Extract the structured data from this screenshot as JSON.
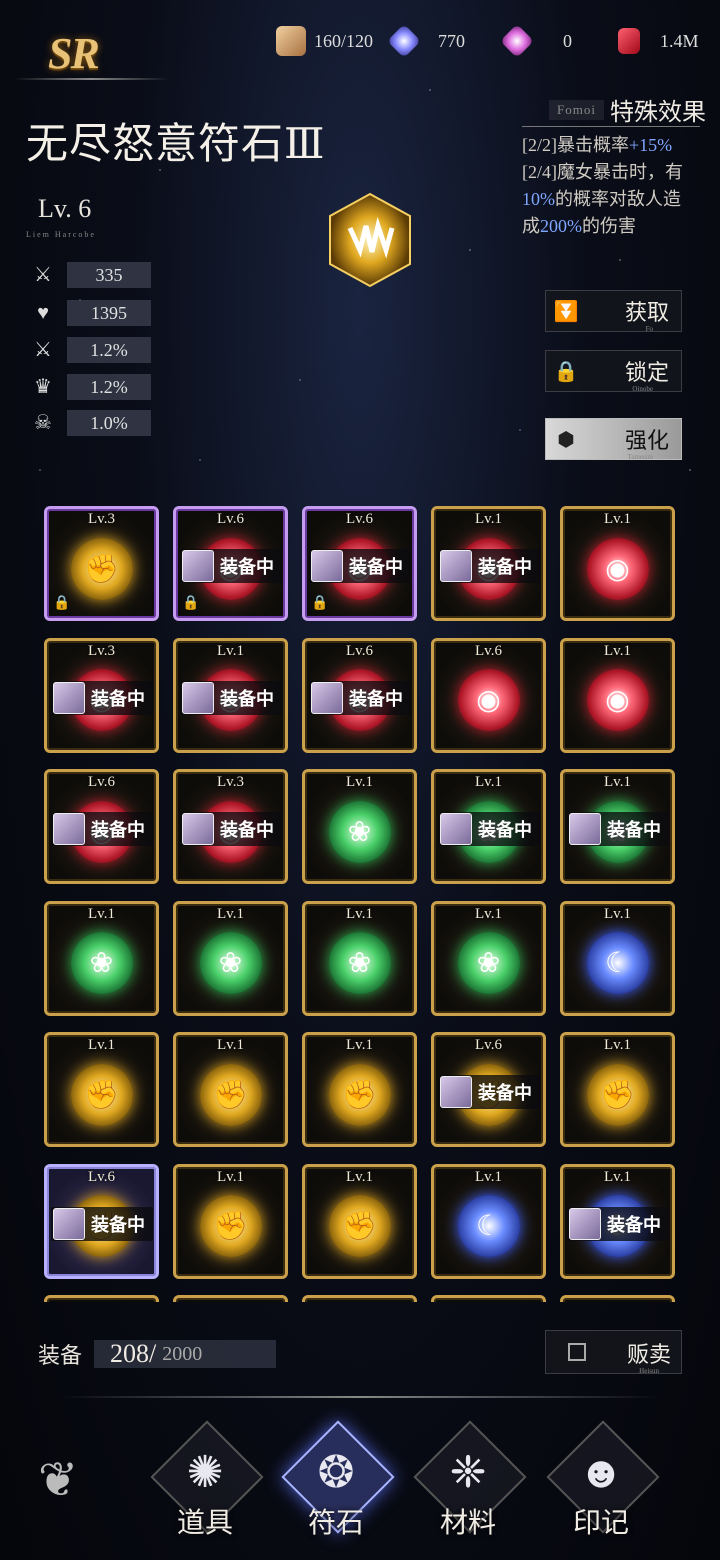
{
  "header": {
    "rarity": "SR",
    "currencies": [
      {
        "icon": "scroll-icon",
        "value": "160/120",
        "color": "#e0b070"
      },
      {
        "icon": "blue-crystal-icon",
        "value": "770",
        "color": "#8a8cff"
      },
      {
        "icon": "pink-crystal-icon",
        "value": "0",
        "color": "#e070e0"
      },
      {
        "icon": "red-gem-icon",
        "value": "1.4M",
        "color": "#e02030"
      }
    ]
  },
  "item": {
    "name": "无尽怒意符石Ⅲ",
    "level": "Lv.  6",
    "level_sub": "Liem Harcobe",
    "stats": [
      {
        "icon": "sword-icon",
        "value": "335"
      },
      {
        "icon": "heart-icon",
        "value": "1395"
      },
      {
        "icon": "crit-sword-icon",
        "value": "1.2%"
      },
      {
        "icon": "crown-icon",
        "value": "1.2%"
      },
      {
        "icon": "skull-icon",
        "value": "1.0%"
      }
    ]
  },
  "special": {
    "en": "Fomoi",
    "title": "特殊效果",
    "line1_prefix": "[2/2]暴击概率",
    "line1_value": "+15%",
    "line2_a": "[2/4]魔女暴击时，有",
    "line2_b": "10%",
    "line2_c": "的概率对敌人造",
    "line2_d": "成",
    "line2_e": "200%",
    "line2_f": "的伤害"
  },
  "buttons": {
    "obtain": {
      "label": "获取",
      "sub": "Fo"
    },
    "lock": {
      "label": "锁定",
      "sub": "Oinobe"
    },
    "enhance": {
      "label": "强化",
      "sub": "Tamesim"
    }
  },
  "grid": {
    "equipped_label": "装备中",
    "rows": [
      [
        {
          "lv": "Lv.3",
          "orb": "yellow",
          "frame": "purple",
          "equipped": false,
          "locked": true
        },
        {
          "lv": "Lv.6",
          "orb": "red",
          "frame": "purple",
          "equipped": true,
          "locked": true
        },
        {
          "lv": "Lv.6",
          "orb": "red",
          "frame": "purple",
          "equipped": true,
          "locked": true
        },
        {
          "lv": "Lv.1",
          "orb": "red",
          "frame": "gold",
          "equipped": true,
          "locked": false
        },
        {
          "lv": "Lv.1",
          "orb": "red",
          "frame": "gold",
          "equipped": false,
          "locked": false
        }
      ],
      [
        {
          "lv": "Lv.3",
          "orb": "red",
          "frame": "gold",
          "equipped": true,
          "locked": false
        },
        {
          "lv": "Lv.1",
          "orb": "red",
          "frame": "gold",
          "equipped": true,
          "locked": false
        },
        {
          "lv": "Lv.6",
          "orb": "red",
          "frame": "gold",
          "equipped": true,
          "locked": false
        },
        {
          "lv": "Lv.6",
          "orb": "red",
          "frame": "gold",
          "equipped": false,
          "locked": false
        },
        {
          "lv": "Lv.1",
          "orb": "red",
          "frame": "gold",
          "equipped": false,
          "locked": false
        }
      ],
      [
        {
          "lv": "Lv.6",
          "orb": "red",
          "frame": "gold",
          "equipped": true,
          "locked": false
        },
        {
          "lv": "Lv.3",
          "orb": "red",
          "frame": "gold",
          "equipped": true,
          "locked": false
        },
        {
          "lv": "Lv.1",
          "orb": "green",
          "frame": "gold",
          "equipped": false,
          "locked": false
        },
        {
          "lv": "Lv.1",
          "orb": "green",
          "frame": "gold",
          "equipped": true,
          "locked": false
        },
        {
          "lv": "Lv.1",
          "orb": "green",
          "frame": "gold",
          "equipped": true,
          "locked": false
        }
      ],
      [
        {
          "lv": "Lv.1",
          "orb": "green",
          "frame": "gold",
          "equipped": false,
          "locked": false
        },
        {
          "lv": "Lv.1",
          "orb": "green",
          "frame": "gold",
          "equipped": false,
          "locked": false
        },
        {
          "lv": "Lv.1",
          "orb": "green",
          "frame": "gold",
          "equipped": false,
          "locked": false
        },
        {
          "lv": "Lv.1",
          "orb": "green",
          "frame": "gold",
          "equipped": false,
          "locked": false
        },
        {
          "lv": "Lv.1",
          "orb": "blue",
          "frame": "gold",
          "equipped": false,
          "locked": false
        }
      ],
      [
        {
          "lv": "Lv.1",
          "orb": "yellow",
          "frame": "gold",
          "equipped": false,
          "locked": false
        },
        {
          "lv": "Lv.1",
          "orb": "yellow",
          "frame": "gold",
          "equipped": false,
          "locked": false
        },
        {
          "lv": "Lv.1",
          "orb": "yellow",
          "frame": "gold",
          "equipped": false,
          "locked": false
        },
        {
          "lv": "Lv.6",
          "orb": "yellow",
          "frame": "gold",
          "equipped": true,
          "locked": false
        },
        {
          "lv": "Lv.1",
          "orb": "yellow",
          "frame": "gold",
          "equipped": false,
          "locked": false
        }
      ],
      [
        {
          "lv": "Lv.6",
          "orb": "yellow",
          "frame": "violet",
          "equipped": true,
          "locked": false
        },
        {
          "lv": "Lv.1",
          "orb": "yellow",
          "frame": "gold",
          "equipped": false,
          "locked": false
        },
        {
          "lv": "Lv.1",
          "orb": "yellow",
          "frame": "gold",
          "equipped": false,
          "locked": false
        },
        {
          "lv": "Lv.1",
          "orb": "blue",
          "frame": "gold",
          "equipped": false,
          "locked": false
        },
        {
          "lv": "Lv.1",
          "orb": "blue",
          "frame": "gold",
          "equipped": true,
          "locked": false
        }
      ],
      [
        {
          "lv": "",
          "orb": "none",
          "frame": "gold",
          "equipped": false,
          "locked": false
        },
        {
          "lv": "",
          "orb": "none",
          "frame": "gold",
          "equipped": false,
          "locked": false
        },
        {
          "lv": "",
          "orb": "none",
          "frame": "gold",
          "equipped": false,
          "locked": false
        },
        {
          "lv": "",
          "orb": "none",
          "frame": "gold",
          "equipped": false,
          "locked": false
        },
        {
          "lv": "",
          "orb": "none",
          "frame": "gold",
          "equipped": false,
          "locked": false
        }
      ]
    ]
  },
  "capacity": {
    "label": "装备",
    "current": "208/",
    "max": "2000"
  },
  "sell": {
    "label": "贩卖",
    "sub": "Heisun"
  },
  "nav": [
    {
      "label": "道具",
      "icon": "sun-emblem-icon",
      "active": false
    },
    {
      "label": "符石",
      "icon": "rune-flame-icon",
      "active": true
    },
    {
      "label": "材料",
      "icon": "ornament-icon",
      "active": false
    },
    {
      "label": "印记",
      "icon": "cat-girl-icon",
      "active": false
    }
  ]
}
